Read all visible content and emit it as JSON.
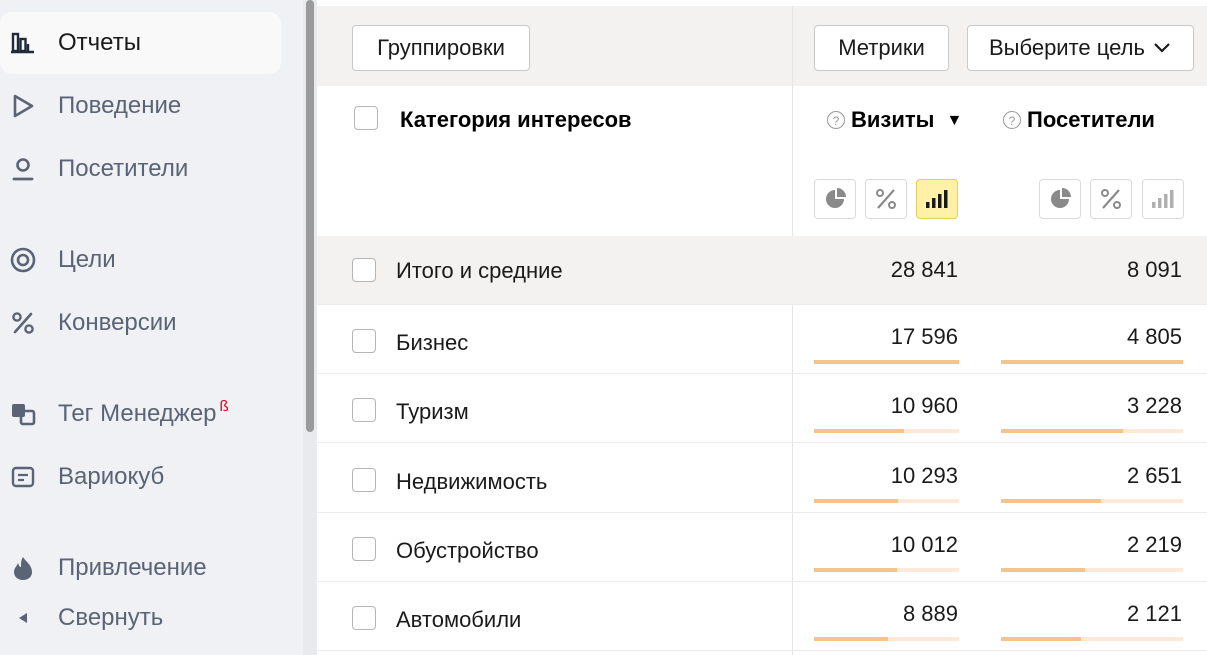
{
  "sidebar": {
    "items": [
      {
        "label": "Отчеты",
        "icon": "bar-chart-icon",
        "active": true
      },
      {
        "label": "Поведение",
        "icon": "play-icon"
      },
      {
        "label": "Посетители",
        "icon": "person-icon"
      },
      {
        "label": "Цели",
        "icon": "target-icon"
      },
      {
        "label": "Конверсии",
        "icon": "percent-icon"
      },
      {
        "label": "Тег Менеджер",
        "icon": "tag-manager-icon",
        "badge": "ß"
      },
      {
        "label": "Вариокуб",
        "icon": "variocube-icon"
      },
      {
        "label": "Привлечение",
        "icon": "flame-icon"
      }
    ],
    "collapse_label": "Свернуть"
  },
  "toolbar": {
    "groupings_label": "Группировки",
    "metrics_label": "Метрики",
    "goal_select_label": "Выберите цель"
  },
  "table": {
    "dimension_header": "Категория интересов",
    "columns": [
      {
        "label": "Визиты",
        "sort": "▼"
      },
      {
        "label": "Посетители"
      }
    ],
    "view_modes": [
      "pie-chart-icon",
      "percent-icon",
      "bar-chart-icon"
    ],
    "total": {
      "label": "Итого и средние",
      "visits": "28 841",
      "visitors": "8 091"
    },
    "rows": [
      {
        "label": "Бизнес",
        "visits": "17 596",
        "visitors": "4 805",
        "visits_share": 1.0,
        "visitors_share": 1.0
      },
      {
        "label": "Туризм",
        "visits": "10 960",
        "visitors": "3 228",
        "visits_share": 0.62,
        "visitors_share": 0.67
      },
      {
        "label": "Недвижимость",
        "visits": "10 293",
        "visitors": "2 651",
        "visits_share": 0.58,
        "visitors_share": 0.55
      },
      {
        "label": "Обустройство",
        "visits": "10 012",
        "visitors": "2 219",
        "visits_share": 0.57,
        "visitors_share": 0.46
      },
      {
        "label": "Автомобили",
        "visits": "8 889",
        "visitors": "2 121",
        "visits_share": 0.51,
        "visitors_share": 0.44
      }
    ]
  },
  "colors": {
    "bar_fill": "#f7c38d",
    "bar_track": "#fde9d7",
    "active_view": "#fff1a8",
    "sidebar_bg": "#f0f1f5",
    "beta_badge": "#d0021b"
  }
}
